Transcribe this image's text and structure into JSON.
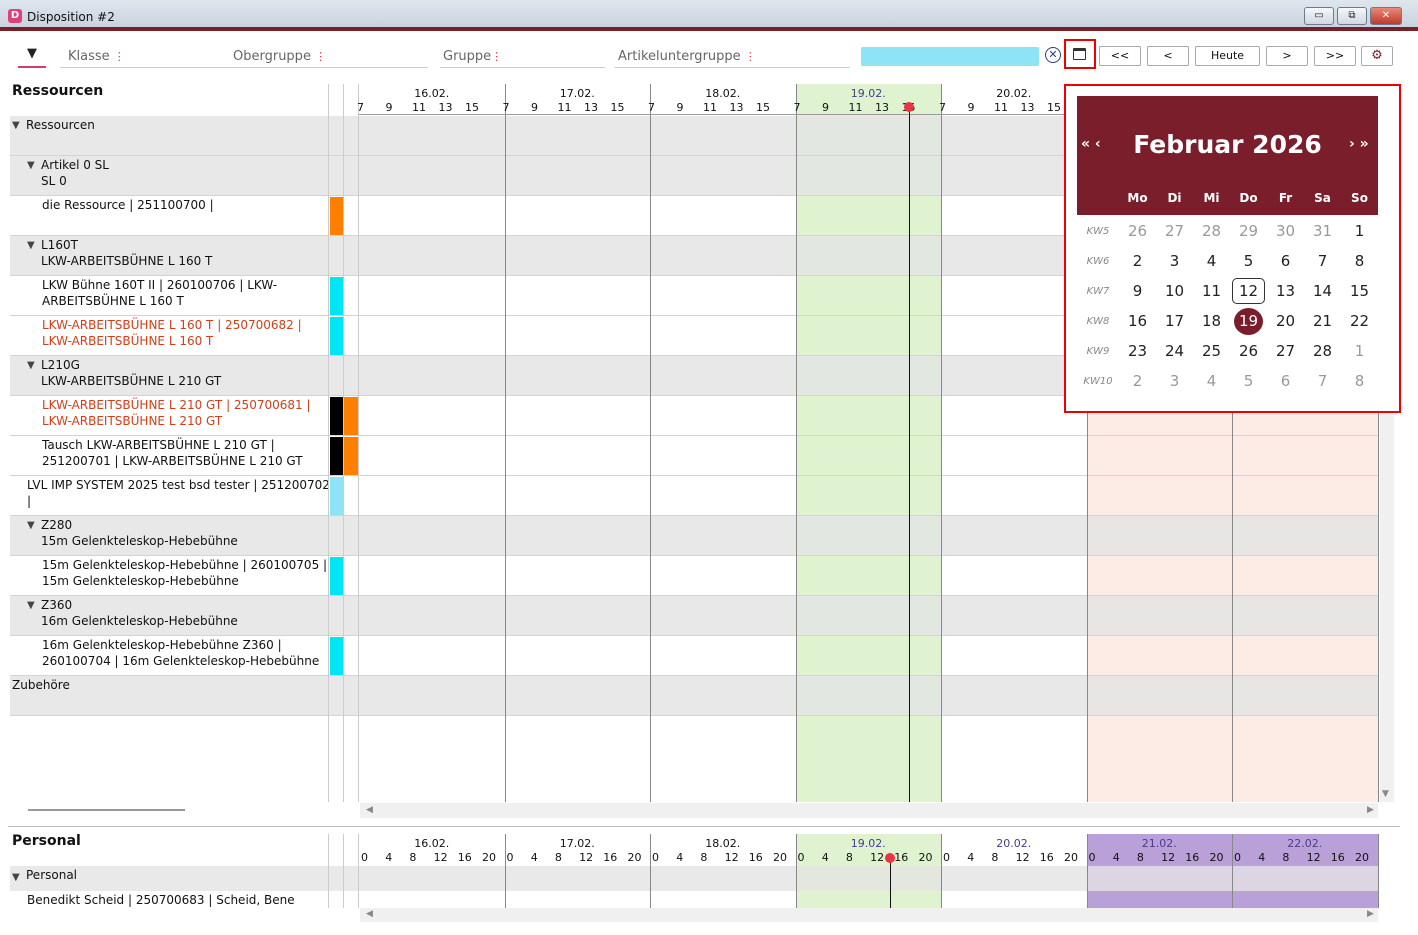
{
  "window": {
    "title": "Disposition #2",
    "icon_letter": "D",
    "btn_min": "▭",
    "btn_max": "⧉",
    "btn_close": "✕"
  },
  "filters": {
    "klasse": "Klasse",
    "obergruppe": "Obergruppe",
    "gruppe": "Gruppe",
    "artikeluntergruppe": "Artikeluntergruppe",
    "dots": "⋮"
  },
  "nav": {
    "first": "<<",
    "prev": "<",
    "today": ">",
    "today_label": "Heute",
    "next": ">",
    "last": ">>"
  },
  "icons": {
    "dropdown": "chevron-down-icon",
    "clear": "clear-circle-icon",
    "calendar": "calendar-icon",
    "gear": "gear-icon"
  },
  "colors": {
    "accent": "#7b1e2c",
    "today_col": "#dff3d0",
    "weekend": "#fdece6",
    "cyan": "#00e5f5",
    "orange": "#ff8000",
    "pale_cyan": "#8ee3f6",
    "purple": "#b9a0d8"
  },
  "resources": {
    "title": "Ressourcen",
    "days": [
      "16.02.",
      "17.02.",
      "18.02.",
      "19.02.",
      "20.02.",
      "21.02.",
      "22.02."
    ],
    "hours": [
      "7",
      "9",
      "11",
      "13",
      "15"
    ],
    "rows": [
      {
        "l1": "Ressourcen",
        "l2": "",
        "grey": true,
        "tri": true,
        "indent": 0,
        "red": false,
        "bars": []
      },
      {
        "l1": "Artikel 0 SL",
        "l2": "SL 0",
        "grey": true,
        "tri": true,
        "indent": 1,
        "red": false,
        "bars": []
      },
      {
        "l1": "die Ressource | 251100700 |",
        "l2": "",
        "grey": false,
        "tri": false,
        "indent": 2,
        "red": false,
        "bars": [
          "orange"
        ]
      },
      {
        "l1": "L160T",
        "l2": "LKW-ARBEITSBÜHNE L 160 T",
        "grey": true,
        "tri": true,
        "indent": 1,
        "red": false,
        "bars": []
      },
      {
        "l1": "LKW Bühne 160T II | 260100706 | LKW-",
        "l2": "ARBEITSBÜHNE L 160 T",
        "grey": false,
        "tri": false,
        "indent": 2,
        "red": false,
        "bars": [
          "cyan"
        ]
      },
      {
        "l1": "LKW-ARBEITSBÜHNE L 160 T | 250700682 |",
        "l2": "LKW-ARBEITSBÜHNE L 160 T",
        "grey": false,
        "tri": false,
        "indent": 2,
        "red": true,
        "bars": [
          "cyan"
        ]
      },
      {
        "l1": "L210G",
        "l2": "LKW-ARBEITSBÜHNE L 210 GT",
        "grey": true,
        "tri": true,
        "indent": 1,
        "red": false,
        "bars": []
      },
      {
        "l1": "LKW-ARBEITSBÜHNE L 210 GT | 250700681 |",
        "l2": "LKW-ARBEITSBÜHNE L 210 GT",
        "grey": false,
        "tri": false,
        "indent": 2,
        "red": true,
        "bars": [
          "black",
          "orange"
        ]
      },
      {
        "l1": "Tausch LKW-ARBEITSBÜHNE L 210 GT |",
        "l2": "251200701 | LKW-ARBEITSBÜHNE L 210 GT",
        "grey": false,
        "tri": false,
        "indent": 2,
        "red": false,
        "bars": [
          "black",
          "orange"
        ]
      },
      {
        "l1": "LVL IMP SYSTEM 2025 test bsd tester | 251200702",
        "l2": "|",
        "grey": false,
        "tri": false,
        "indent": 1,
        "red": false,
        "bars": [
          "palecyan"
        ]
      },
      {
        "l1": "Z280",
        "l2": "15m Gelenkteleskop-Hebebühne",
        "grey": true,
        "tri": true,
        "indent": 1,
        "red": false,
        "bars": []
      },
      {
        "l1": "15m Gelenkteleskop-Hebebühne | 260100705 |",
        "l2": "15m Gelenkteleskop-Hebebühne",
        "grey": false,
        "tri": false,
        "indent": 2,
        "red": false,
        "bars": [
          "cyan"
        ]
      },
      {
        "l1": "Z360",
        "l2": "16m Gelenkteleskop-Hebebühne",
        "grey": true,
        "tri": true,
        "indent": 1,
        "red": false,
        "bars": []
      },
      {
        "l1": "16m Gelenkteleskop-Hebebühne Z360 |",
        "l2": "260100704 | 16m Gelenkteleskop-Hebebühne",
        "grey": false,
        "tri": false,
        "indent": 2,
        "red": false,
        "bars": [
          "cyan"
        ]
      },
      {
        "l1": "Zubehöre",
        "l2": "",
        "grey": true,
        "tri": false,
        "indent": 0,
        "red": false,
        "bars": []
      }
    ]
  },
  "personal": {
    "title": "Personal",
    "hours": [
      "0",
      "4",
      "8",
      "12",
      "16",
      "20"
    ],
    "group": "Personal",
    "row": "Benedikt Scheid | 250700683 | Scheid, Bene"
  },
  "calendar": {
    "month": "Februar 2026",
    "nav_prev": "« ‹",
    "nav_next": "› »",
    "weekdays": [
      "Mo",
      "Di",
      "Mi",
      "Do",
      "Fr",
      "Sa",
      "So"
    ],
    "weeks": [
      {
        "kw": "KW5",
        "days": [
          "26",
          "27",
          "28",
          "29",
          "30",
          "31",
          "1"
        ]
      },
      {
        "kw": "KW6",
        "days": [
          "2",
          "3",
          "4",
          "5",
          "6",
          "7",
          "8"
        ]
      },
      {
        "kw": "KW7",
        "days": [
          "9",
          "10",
          "11",
          "12",
          "13",
          "14",
          "15"
        ]
      },
      {
        "kw": "KW8",
        "days": [
          "16",
          "17",
          "18",
          "19",
          "20",
          "21",
          "22"
        ]
      },
      {
        "kw": "KW9",
        "days": [
          "23",
          "24",
          "25",
          "26",
          "27",
          "28",
          "1"
        ]
      },
      {
        "kw": "KW10",
        "days": [
          "2",
          "3",
          "4",
          "5",
          "6",
          "7",
          "8"
        ]
      }
    ],
    "today": "12",
    "selected": "19"
  }
}
